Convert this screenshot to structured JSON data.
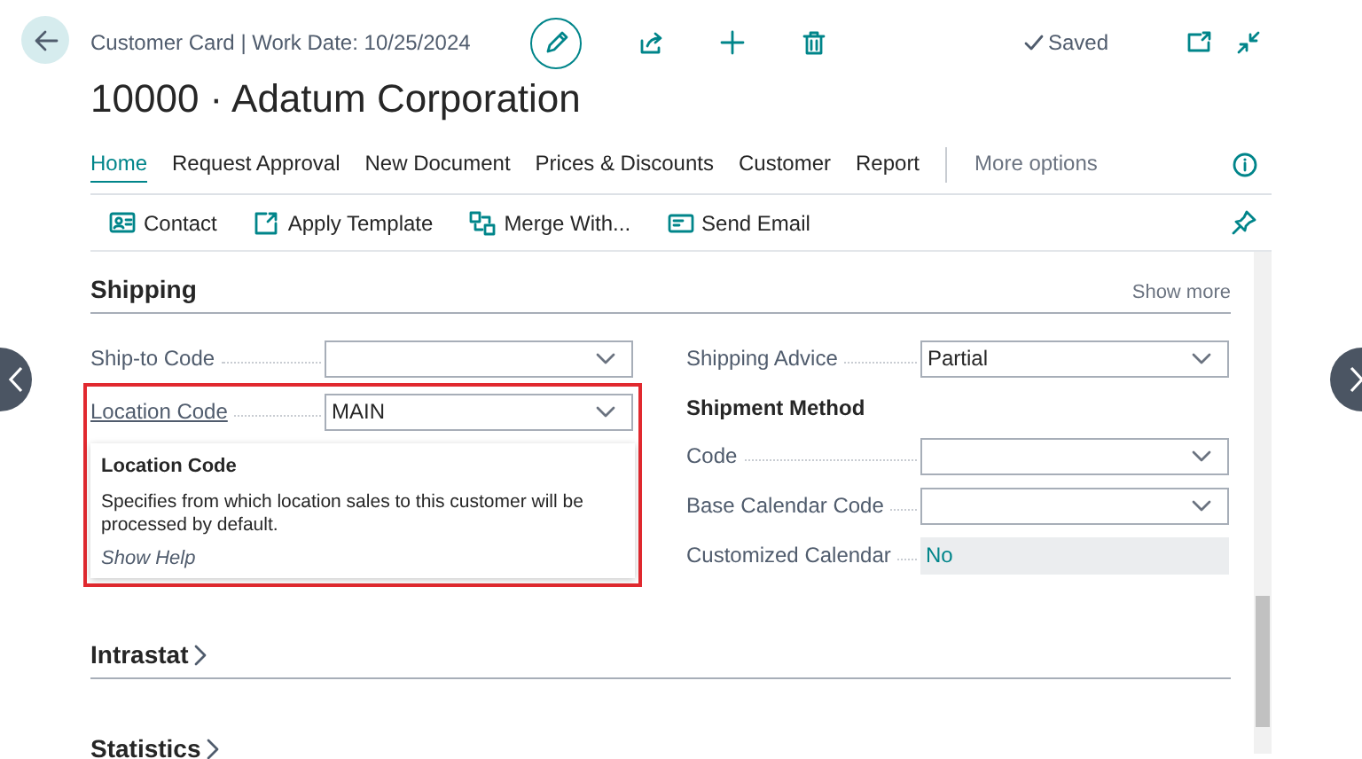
{
  "header": {
    "breadcrumb": "Customer Card | Work Date: 10/25/2024",
    "title": "10000 · Adatum Corporation",
    "status": "Saved"
  },
  "action_tabs": [
    {
      "label": "Home",
      "selected": true
    },
    {
      "label": "Request Approval",
      "selected": false
    },
    {
      "label": "New Document",
      "selected": false
    },
    {
      "label": "Prices & Discounts",
      "selected": false
    },
    {
      "label": "Customer",
      "selected": false
    },
    {
      "label": "Report",
      "selected": false
    }
  ],
  "more_options": "More options",
  "toolbar": [
    {
      "label": "Contact",
      "kind": "contact"
    },
    {
      "label": "Apply Template",
      "kind": "template"
    },
    {
      "label": "Merge With...",
      "kind": "merge"
    },
    {
      "label": "Send Email",
      "kind": "email"
    }
  ],
  "sections": [
    {
      "title": "Shipping",
      "kind": "expanded",
      "show_more": "Show more",
      "left": [
        {
          "kind": "dropdown",
          "label": "Ship-to Code"
        },
        {
          "kind": "dropdown",
          "label": "Location Code",
          "value": "MAIN",
          "highlighted": true,
          "tooltip": {
            "title": "Location Code",
            "text": "Specifies from which location sales to this customer will be processed by default.",
            "link": "Show Help"
          }
        }
      ],
      "right": [
        {
          "kind": "dropdown",
          "label": "Shipping Advice",
          "value": "Partial"
        },
        {
          "kind": "group",
          "label": "Shipment Method"
        },
        {
          "kind": "dropdown",
          "label": "Code"
        },
        {
          "kind": "dropdown",
          "label": "Base Calendar Code"
        },
        {
          "kind": "readonly",
          "label": "Customized Calendar",
          "value": "No"
        }
      ]
    },
    {
      "title": "Intrastat",
      "kind": "collapsed"
    },
    {
      "title": "Statistics",
      "kind": "collapsed"
    }
  ]
}
